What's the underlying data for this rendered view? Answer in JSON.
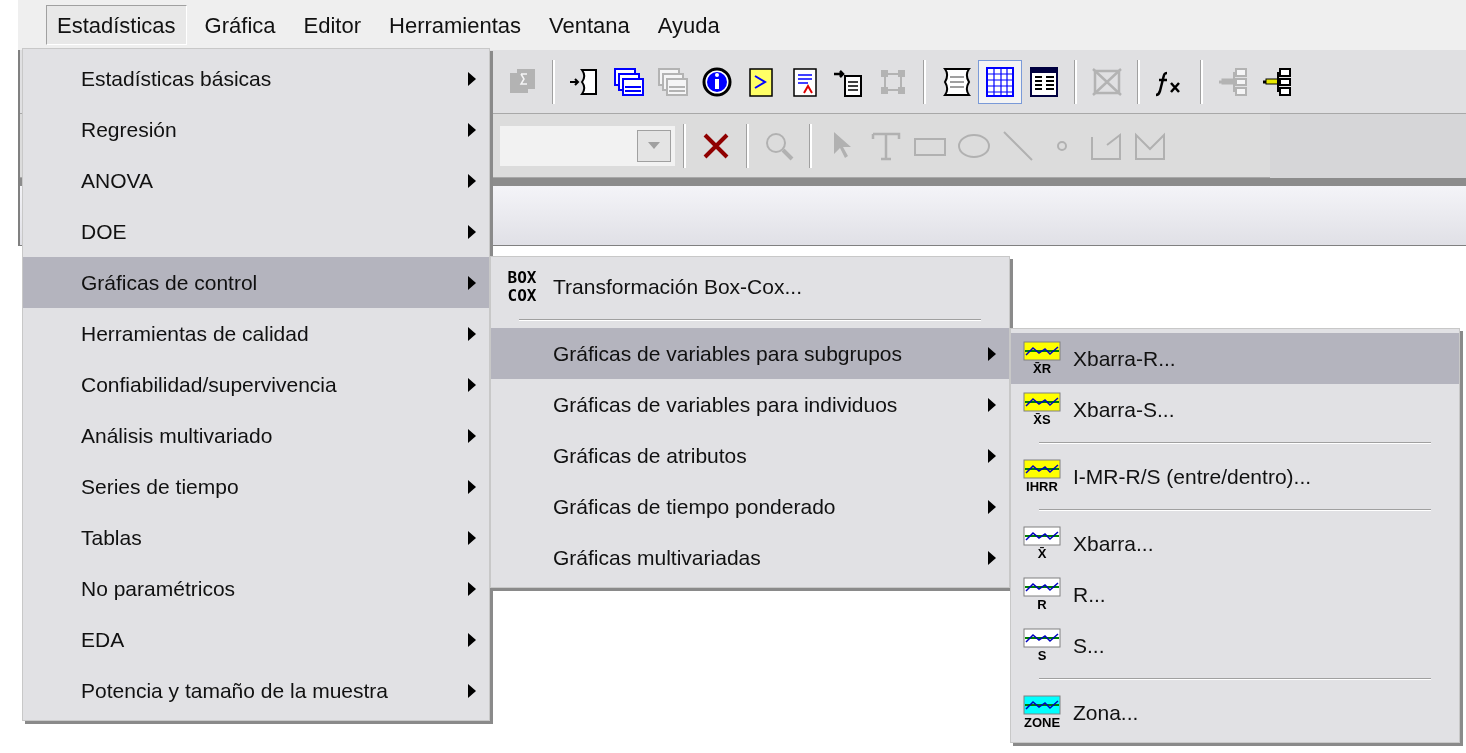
{
  "menu_bar": [
    {
      "label": "Estadísticas",
      "selected": true
    },
    {
      "label": "Gráfica",
      "selected": false
    },
    {
      "label": "Editor",
      "selected": false
    },
    {
      "label": "Herramientas",
      "selected": false
    },
    {
      "label": "Ventana",
      "selected": false
    },
    {
      "label": "Ayuda",
      "selected": false
    }
  ],
  "toolbar_rows": [
    [
      {
        "kind": "sigma",
        "disabled": true,
        "selected": false
      },
      {
        "kind": "separator"
      },
      {
        "kind": "script",
        "disabled": false,
        "selected": false
      },
      {
        "kind": "windows",
        "disabled": false,
        "selected": false
      },
      {
        "kind": "windows",
        "disabled": true,
        "selected": false
      },
      {
        "kind": "info",
        "disabled": false,
        "selected": false
      },
      {
        "kind": "prompt",
        "disabled": false,
        "selected": false
      },
      {
        "kind": "report",
        "disabled": false,
        "selected": false
      },
      {
        "kind": "import",
        "disabled": false,
        "selected": false
      },
      {
        "kind": "nodes",
        "disabled": true,
        "selected": false
      },
      {
        "kind": "separator"
      },
      {
        "kind": "scroll",
        "disabled": false,
        "selected": false
      },
      {
        "kind": "grid",
        "disabled": false,
        "selected": true
      },
      {
        "kind": "table",
        "disabled": false,
        "selected": false
      },
      {
        "kind": "separator"
      },
      {
        "kind": "crossbox",
        "disabled": true,
        "selected": false
      },
      {
        "kind": "separator"
      },
      {
        "kind": "fx",
        "disabled": false,
        "selected": false
      },
      {
        "kind": "separator"
      },
      {
        "kind": "tree",
        "disabled": true,
        "selected": false
      },
      {
        "kind": "tree",
        "disabled": false,
        "selected": false
      }
    ],
    [
      {
        "kind": "dropdown"
      },
      {
        "kind": "separator"
      },
      {
        "kind": "delete",
        "disabled": false,
        "selected": false
      },
      {
        "kind": "separator"
      },
      {
        "kind": "zoom",
        "disabled": true,
        "selected": false
      },
      {
        "kind": "separator"
      },
      {
        "kind": "pointer",
        "disabled": true,
        "selected": false
      },
      {
        "kind": "text",
        "disabled": true,
        "selected": false
      },
      {
        "kind": "rect",
        "disabled": true,
        "selected": false
      },
      {
        "kind": "ellipse",
        "disabled": true,
        "selected": false
      },
      {
        "kind": "line",
        "disabled": true,
        "selected": false
      },
      {
        "kind": "dot",
        "disabled": true,
        "selected": false
      },
      {
        "kind": "polyline",
        "disabled": true,
        "selected": false
      },
      {
        "kind": "polygon",
        "disabled": true,
        "selected": false
      }
    ]
  ],
  "menus": [
    {
      "items": [
        {
          "kind": "item",
          "label": "Estadísticas básicas",
          "selected": false,
          "submenu": true
        },
        {
          "kind": "item",
          "label": "Regresión",
          "selected": false,
          "submenu": true
        },
        {
          "kind": "item",
          "label": "ANOVA",
          "selected": false,
          "submenu": true
        },
        {
          "kind": "item",
          "label": "DOE",
          "selected": false,
          "submenu": true
        },
        {
          "kind": "item",
          "label": "Gráficas de control",
          "selected": true,
          "submenu": true
        },
        {
          "kind": "item",
          "label": "Herramientas de calidad",
          "selected": false,
          "submenu": true
        },
        {
          "kind": "item",
          "label": "Confiabilidad/supervivencia",
          "selected": false,
          "submenu": true
        },
        {
          "kind": "item",
          "label": "Análisis multivariado",
          "selected": false,
          "submenu": true
        },
        {
          "kind": "item",
          "label": "Series de tiempo",
          "selected": false,
          "submenu": true
        },
        {
          "kind": "item",
          "label": "Tablas",
          "selected": false,
          "submenu": true
        },
        {
          "kind": "item",
          "label": "No paramétricos",
          "selected": false,
          "submenu": true
        },
        {
          "kind": "item",
          "label": "EDA",
          "selected": false,
          "submenu": true
        },
        {
          "kind": "item",
          "label": "Potencia y tamaño de la muestra",
          "selected": false,
          "submenu": true
        }
      ]
    },
    {
      "items": [
        {
          "kind": "text_icon",
          "label": "Transformación Box-Cox...",
          "selected": false,
          "submenu": false,
          "icon_text": "BOX COX"
        },
        {
          "kind": "separator"
        },
        {
          "kind": "item",
          "label": "Gráficas de variables para subgrupos",
          "selected": true,
          "submenu": true
        },
        {
          "kind": "item",
          "label": "Gráficas de variables para individuos",
          "selected": false,
          "submenu": true
        },
        {
          "kind": "item",
          "label": "Gráficas de atributos",
          "selected": false,
          "submenu": true
        },
        {
          "kind": "item",
          "label": "Gráficas de tiempo ponderado",
          "selected": false,
          "submenu": true
        },
        {
          "kind": "item",
          "label": "Gráficas multivariadas",
          "selected": false,
          "submenu": true
        }
      ]
    },
    {
      "items": [
        {
          "kind": "chart_icon",
          "label": "Xbarra-R...",
          "selected": true,
          "submenu": false,
          "icon_text": "X̄R",
          "color": "#ffff00"
        },
        {
          "kind": "chart_icon",
          "label": "Xbarra-S...",
          "selected": false,
          "submenu": false,
          "icon_text": "X̄S",
          "color": "#ffff00"
        },
        {
          "kind": "separator"
        },
        {
          "kind": "chart_icon",
          "label": "I-MR-R/S (entre/dentro)...",
          "selected": false,
          "submenu": false,
          "icon_text": "IHRR",
          "color": "#ffff00"
        },
        {
          "kind": "separator"
        },
        {
          "kind": "chart_icon",
          "label": "Xbarra...",
          "selected": false,
          "submenu": false,
          "icon_text": "X̄",
          "color": "#ffffff"
        },
        {
          "kind": "chart_icon",
          "label": "R...",
          "selected": false,
          "submenu": false,
          "icon_text": "R",
          "color": "#ffffff"
        },
        {
          "kind": "chart_icon",
          "label": "S...",
          "selected": false,
          "submenu": false,
          "icon_text": "S",
          "color": "#ffffff"
        },
        {
          "kind": "separator"
        },
        {
          "kind": "chart_icon",
          "label": "Zona...",
          "selected": false,
          "submenu": false,
          "icon_text": "ZONE",
          "color": "#00ffff"
        }
      ]
    }
  ]
}
